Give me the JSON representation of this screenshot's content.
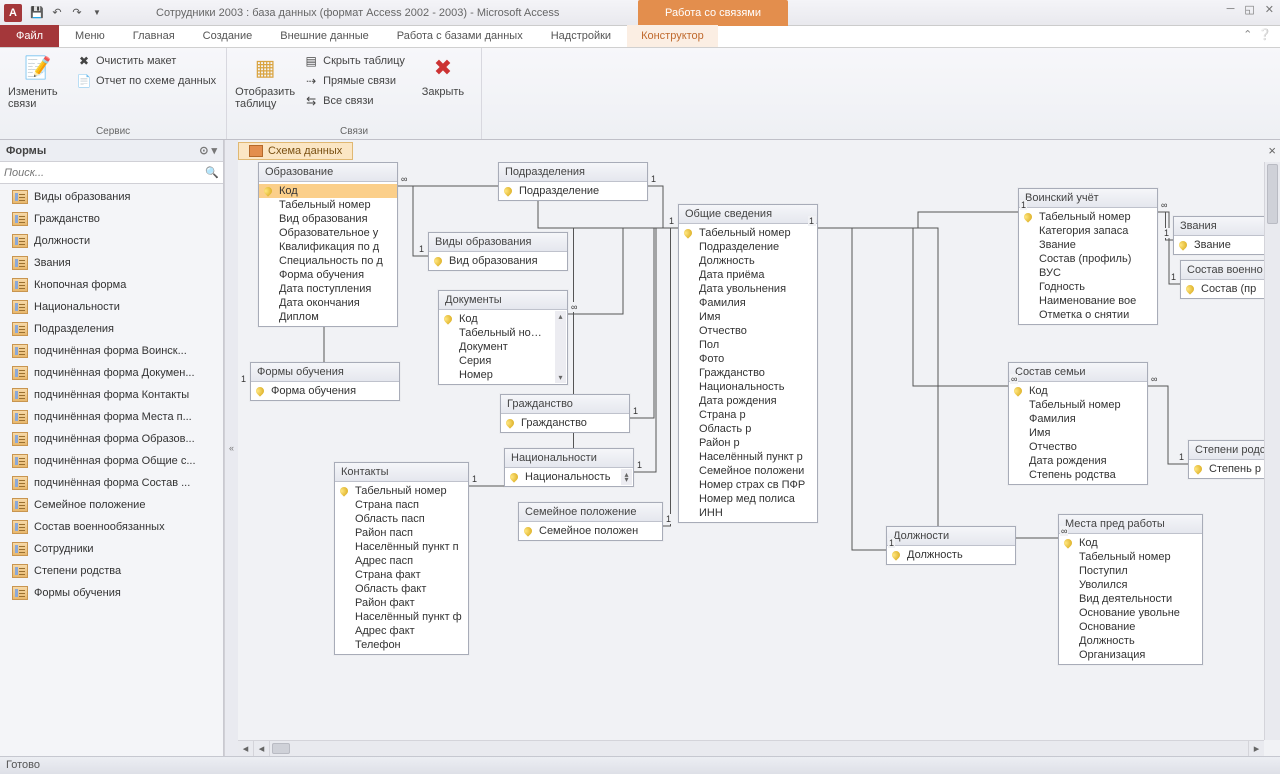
{
  "title": "Сотрудники 2003 : база данных (формат Access 2002 - 2003)  -  Microsoft Access",
  "context_tab_group": "Работа со связями",
  "tabs": {
    "file": "Файл",
    "menu": "Меню",
    "home": "Главная",
    "create": "Создание",
    "external": "Внешние данные",
    "db": "Работа с базами данных",
    "addins": "Надстройки",
    "designer": "Конструктор"
  },
  "ribbon": {
    "group1_label": "Сервис",
    "edit_rel": "Изменить связи",
    "clear_layout": "Очистить макет",
    "report": "Отчет по схеме данных",
    "group2_label": "Связи",
    "show_table": "Отобразить таблицу",
    "hide_table": "Скрыть таблицу",
    "direct": "Прямые связи",
    "all_rel": "Все связи",
    "close": "Закрыть"
  },
  "nav": {
    "header": "Формы",
    "search_placeholder": "Поиск...",
    "items": [
      "Виды образования",
      "Гражданство",
      "Должности",
      "Звания",
      "Кнопочная форма",
      "Национальности",
      "Подразделения",
      "подчинённая форма Воинск...",
      "подчинённая форма Докумен...",
      "подчинённая форма Контакты",
      "подчинённая форма Места п...",
      "подчинённая форма Образов...",
      "подчинённая форма Общие с...",
      "подчинённая форма Состав ...",
      "Семейное положение",
      "Состав военнообязанных",
      "Сотрудники",
      "Степени родства",
      "Формы обучения"
    ]
  },
  "doc_tab": "Схема данных",
  "status": "Готово",
  "tables": {
    "obr": {
      "title": "Образование",
      "fields": [
        "Код",
        "Табельный номер",
        "Вид образования",
        "Образовательное у",
        "Квалификация по д",
        "Специальность по д",
        "Форма обучения",
        "Дата поступления",
        "Дата окончания",
        "Диплом"
      ],
      "key": [
        0
      ],
      "sel": 0
    },
    "vid": {
      "title": "Виды образования",
      "fields": [
        "Вид образования"
      ],
      "key": [
        0
      ]
    },
    "formob": {
      "title": "Формы обучения",
      "fields": [
        "Форма обучения"
      ],
      "key": [
        0
      ]
    },
    "doc": {
      "title": "Документы",
      "fields": [
        "Код",
        "Табельный номер",
        "Документ",
        "Серия",
        "Номер"
      ],
      "key": [
        0
      ],
      "scroll": true
    },
    "podr": {
      "title": "Подразделения",
      "fields": [
        "Подразделение"
      ],
      "key": [
        0
      ]
    },
    "kont": {
      "title": "Контакты",
      "fields": [
        "Табельный номер",
        "Страна пасп",
        "Область пасп",
        "Район пасп",
        "Населённый пункт п",
        "Адрес пасп",
        "Страна факт",
        "Область факт",
        "Район факт",
        "Населённый пункт ф",
        "Адрес факт",
        "Телефон"
      ],
      "key": [
        0
      ]
    },
    "grazh": {
      "title": "Гражданство",
      "fields": [
        "Гражданство"
      ],
      "key": [
        0
      ]
    },
    "nat": {
      "title": "Национальности",
      "fields": [
        "Национальность"
      ],
      "key": [
        0
      ],
      "scroll": true
    },
    "sem": {
      "title": "Семейное положение",
      "fields": [
        "Семейное положен"
      ],
      "key": [
        0
      ]
    },
    "obsh": {
      "title": "Общие сведения",
      "fields": [
        "Табельный номер",
        "Подразделение",
        "Должность",
        "Дата приёма",
        "Дата увольнения",
        "Фамилия",
        "Имя",
        "Отчество",
        "Пол",
        "Фото",
        "Гражданство",
        "Национальность",
        "Дата рождения",
        "Страна р",
        "Область р",
        "Район р",
        "Населённый пункт р",
        "Семейное положени",
        "Номер страх св ПФР",
        "Номер мед полиса",
        "ИНН"
      ],
      "key": [
        0
      ]
    },
    "dolzh": {
      "title": "Должности",
      "fields": [
        "Должность"
      ],
      "key": [
        0
      ]
    },
    "voin": {
      "title": "Воинский учёт",
      "fields": [
        "Табельный номер",
        "Категория запаса",
        "Звание",
        "Состав (профиль)",
        "ВУС",
        "Годность",
        "Наименование вое",
        "Отметка о снятии"
      ],
      "key": [
        0
      ]
    },
    "zvan": {
      "title": "Звания",
      "fields": [
        "Звание"
      ],
      "key": [
        0
      ]
    },
    "sv": {
      "title": "Состав военно",
      "fields": [
        "Состав (пр"
      ],
      "key": [
        0
      ]
    },
    "sost": {
      "title": "Состав семьи",
      "fields": [
        "Код",
        "Табельный номер",
        "Фамилия",
        "Имя",
        "Отчество",
        "Дата рождения",
        "Степень родства"
      ],
      "key": [
        0
      ]
    },
    "step": {
      "title": "Степени родст",
      "fields": [
        "Степень р"
      ],
      "key": [
        0
      ]
    },
    "mesta": {
      "title": "Места пред работы",
      "fields": [
        "Код",
        "Табельный номер",
        "Поступил",
        "Уволился",
        "Вид деятельности",
        "Основание увольне",
        "Основание",
        "Должность",
        "Организация"
      ],
      "key": [
        0
      ]
    }
  }
}
